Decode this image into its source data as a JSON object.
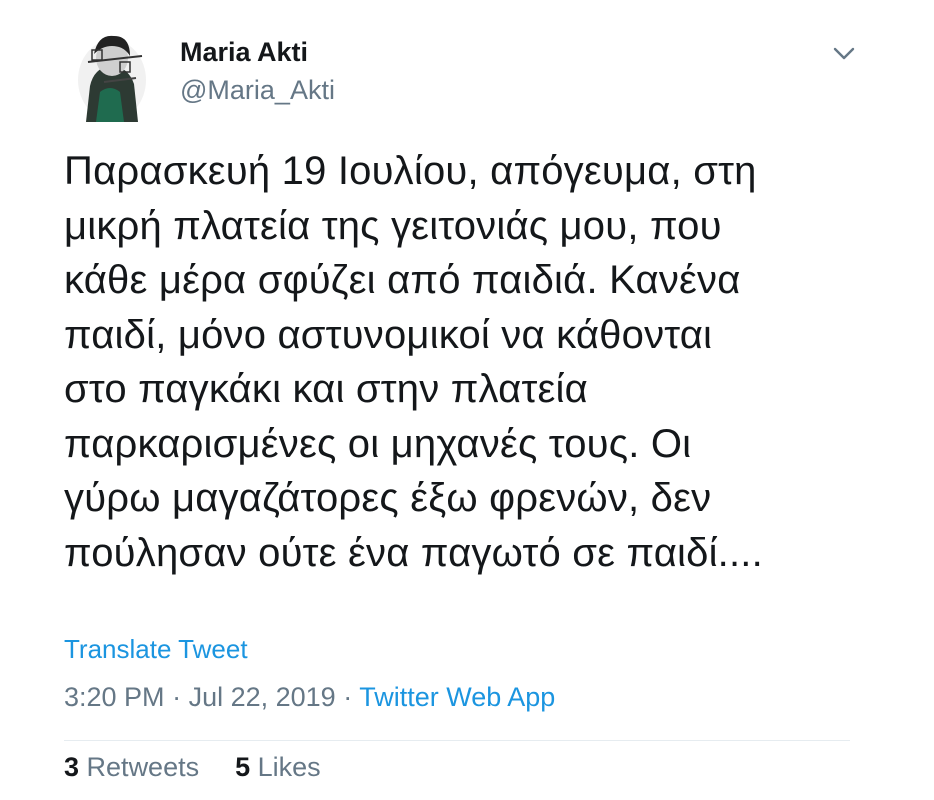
{
  "author": {
    "display_name": "Maria Akti",
    "handle": "@Maria_Akti",
    "avatar_icon": "avatar-image"
  },
  "tweet": {
    "lines": [
      "Παρασκευή 19 Ιουλίου, απόγευμα, στη",
      "μικρή πλατεία της γειτονιάς μου, που",
      "κάθε μέρα σφύζει από παιδιά. Κανένα",
      "παιδί, μόνο αστυνομικοί να κάθονται",
      "στο παγκάκι και στην πλατεία",
      "παρκαρισμένες οι μηχανές τους. Οι",
      "γύρω μαγαζάτορες έξω φρενών, δεν",
      "πούλησαν ούτε ένα παγωτό σε παιδί...."
    ],
    "translate_label": "Translate Tweet",
    "time": "3:20 PM",
    "separator": " · ",
    "date": "Jul 22, 2019",
    "source": "Twitter Web App"
  },
  "stats": {
    "retweets_count": "3",
    "retweets_label": "Retweets",
    "likes_count": "5",
    "likes_label": "Likes"
  },
  "colors": {
    "link": "#1b95e0",
    "secondary_text": "#657786",
    "primary_text": "#14171a"
  }
}
